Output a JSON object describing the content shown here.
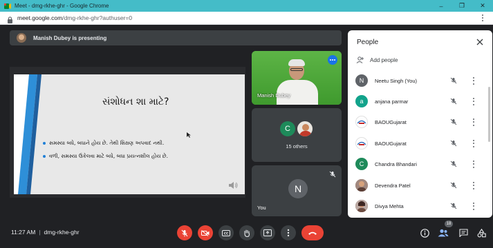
{
  "browser": {
    "window_title": "Meet - dmg-rkhe-ghr - Google Chrome",
    "url_host": "meet.google.com",
    "url_path": "/dmg-rkhe-ghr?authuser=0",
    "controls": {
      "minimize": "–",
      "restore": "❐",
      "close": "✕"
    }
  },
  "presenting": {
    "text": "Manish Dubey is presenting"
  },
  "slide": {
    "title": "સંશોધન શા માટે?",
    "bullets": [
      "સમસ્યા બધે, બધાને હોય છે. તેથી શિક્ષણ અપવાદ નથી.",
      "વળી, સમસ્યા ઉકેલવા માટે બધે, બધા પ્રયત્નશીલ હોય છે."
    ]
  },
  "tiles": {
    "presenter_name": "Manish Dubey",
    "others_initial": "C",
    "others_label": "15 others",
    "you_initial": "N",
    "you_label": "You"
  },
  "people_panel": {
    "title": "People",
    "add_people": "Add people",
    "participants": [
      {
        "name": "Neetu Singh (You)",
        "initial": "N",
        "color": "#5f6368"
      },
      {
        "name": "anjana parmar",
        "initial": "a",
        "color": "#12a38b"
      },
      {
        "name": "BAOUGujarat",
        "initial": "",
        "color": "#ffffff"
      },
      {
        "name": "BAOUGujarat",
        "initial": "",
        "color": "#ffffff"
      },
      {
        "name": "Chandra Bhandari",
        "initial": "C",
        "color": "#1e8a5a"
      },
      {
        "name": "Devendra Patel",
        "initial": "",
        "color": "#8d6e63"
      },
      {
        "name": "Divya Mehta",
        "initial": "",
        "color": "#6d4c41"
      }
    ]
  },
  "bottom_bar": {
    "time": "11:27 AM",
    "meeting_code": "dmg-rkhe-ghr",
    "participant_count": "18"
  },
  "colors": {
    "meet_bg": "#202124",
    "danger_red": "#ea4335",
    "chrome_frame": "#44bcc8",
    "accent_blue": "#1a73e8"
  }
}
